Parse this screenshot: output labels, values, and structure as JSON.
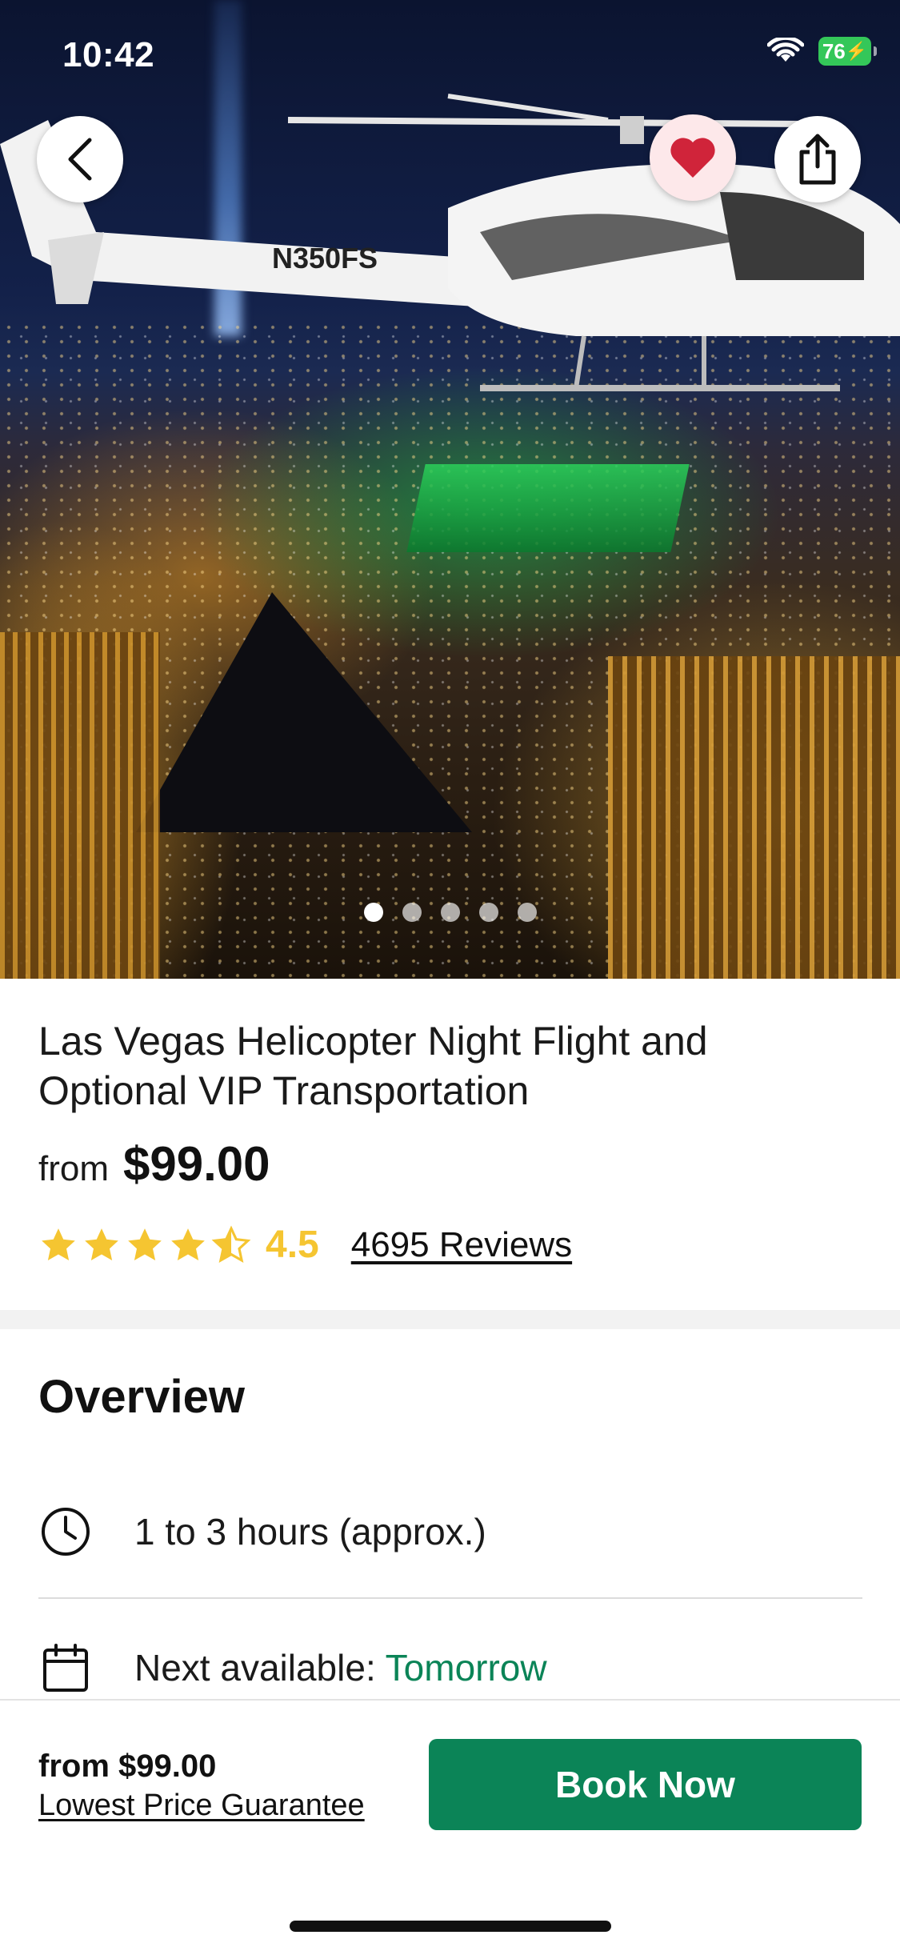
{
  "status_bar": {
    "time": "10:42",
    "battery": "76"
  },
  "hero": {
    "image_alt": "Helicopter flying over Las Vegas at night",
    "slides": 5,
    "active_slide": 0,
    "helicopter_registration": "N350FS"
  },
  "tour": {
    "title": "Las Vegas Helicopter Night Flight and Optional VIP Transportation",
    "from_label": "from",
    "price": "$99.00",
    "rating": "4.5",
    "rating_value": 4.5,
    "reviews": "4695 Reviews"
  },
  "overview": {
    "heading": "Overview",
    "duration": "1 to 3 hours (approx.)",
    "next_available_label": "Next available:",
    "next_available_value": "Tomorrow"
  },
  "bottom_bar": {
    "price_text": "from $99.00",
    "guarantee": "Lowest Price Guarantee",
    "book_label": "Book Now"
  },
  "colors": {
    "accent_green": "#0b8457",
    "star_yellow": "#f5c531",
    "heart_red": "#d0243a"
  }
}
